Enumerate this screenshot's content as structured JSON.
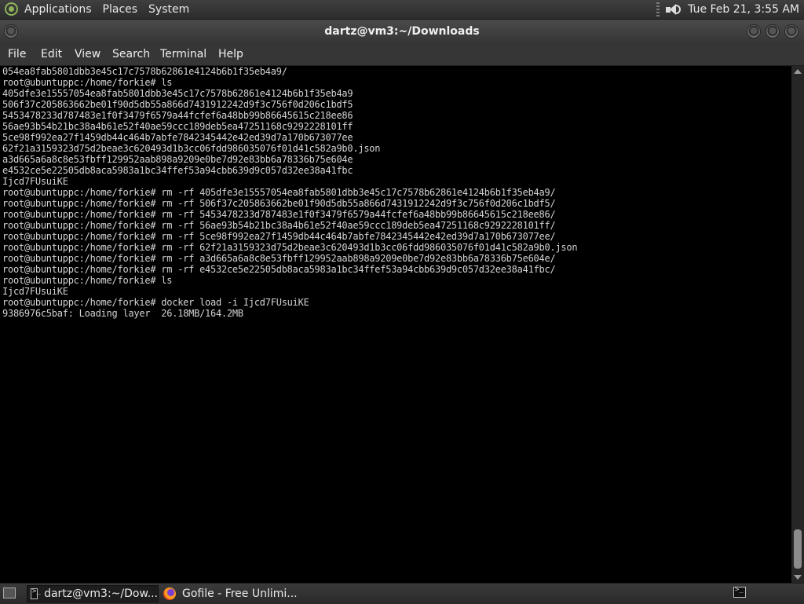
{
  "top_panel": {
    "menu": [
      "Applications",
      "Places",
      "System"
    ],
    "clock": "Tue Feb 21,  3:55 AM",
    "icons": [
      "distro-logo-icon",
      "volume-icon"
    ]
  },
  "window": {
    "title": "dartz@vm3:~/Downloads",
    "menubar": [
      "File",
      "Edit",
      "View",
      "Search",
      "Terminal",
      "Help"
    ]
  },
  "terminal": {
    "lines": [
      "054ea8fab5801dbb3e45c17c7578b62861e4124b6b1f35eb4a9/",
      "root@ubuntuppc:/home/forkie# ls",
      "405dfe3e15557054ea8fab5801dbb3e45c17c7578b62861e4124b6b1f35eb4a9",
      "506f37c205863662be01f90d5db55a866d7431912242d9f3c756f0d206c1bdf5",
      "5453478233d787483e1f0f3479f6579a44fcfef6a48bb99b86645615c218ee86",
      "56ae93b54b21bc38a4b61e52f40ae59ccc189deb5ea47251168c9292228101ff",
      "5ce98f992ea27f1459db44c464b7abfe7842345442e42ed39d7a170b673077ee",
      "62f21a3159323d75d2beae3c620493d1b3cc06fdd986035076f01d41c582a9b0.json",
      "a3d665a6a8c8e53fbff129952aab898a9209e0be7d92e83bb6a78336b75e604e",
      "e4532ce5e22505db8aca5983a1bc34ffef53a94cbb639d9c057d32ee38a41fbc",
      "Ijcd7FUsuiKE",
      "root@ubuntuppc:/home/forkie# rm -rf 405dfe3e15557054ea8fab5801dbb3e45c17c7578b62861e4124b6b1f35eb4a9/",
      "root@ubuntuppc:/home/forkie# rm -rf 506f37c205863662be01f90d5db55a866d7431912242d9f3c756f0d206c1bdf5/",
      "root@ubuntuppc:/home/forkie# rm -rf 5453478233d787483e1f0f3479f6579a44fcfef6a48bb99b86645615c218ee86/",
      "root@ubuntuppc:/home/forkie# rm -rf 56ae93b54b21bc38a4b61e52f40ae59ccc189deb5ea47251168c9292228101ff/",
      "root@ubuntuppc:/home/forkie# rm -rf 5ce98f992ea27f1459db44c464b7abfe7842345442e42ed39d7a170b673077ee/",
      "root@ubuntuppc:/home/forkie# rm -rf 62f21a3159323d75d2beae3c620493d1b3cc06fdd986035076f01d41c582a9b0.json",
      "root@ubuntuppc:/home/forkie# rm -rf a3d665a6a8c8e53fbff129952aab898a9209e0be7d92e83bb6a78336b75e604e/",
      "root@ubuntuppc:/home/forkie# rm -rf e4532ce5e22505db8aca5983a1bc34ffef53a94cbb639d9c057d32ee38a41fbc/",
      "root@ubuntuppc:/home/forkie# ls",
      "Ijcd7FUsuiKE",
      "root@ubuntuppc:/home/forkie# docker load -i Ijcd7FUsuiKE",
      "9386976c5baf: Loading layer  26.18MB/164.2MB"
    ]
  },
  "taskbar": {
    "tasks": [
      {
        "label": "dartz@vm3:~/Dow...",
        "icon": "terminal-icon"
      },
      {
        "label": "Gofile - Free Unlimi...",
        "icon": "firefox-icon"
      }
    ]
  },
  "colors": {
    "terminal_bg": "#000000",
    "terminal_fg": "#d3d3d3",
    "panel_bg": "#333333"
  }
}
